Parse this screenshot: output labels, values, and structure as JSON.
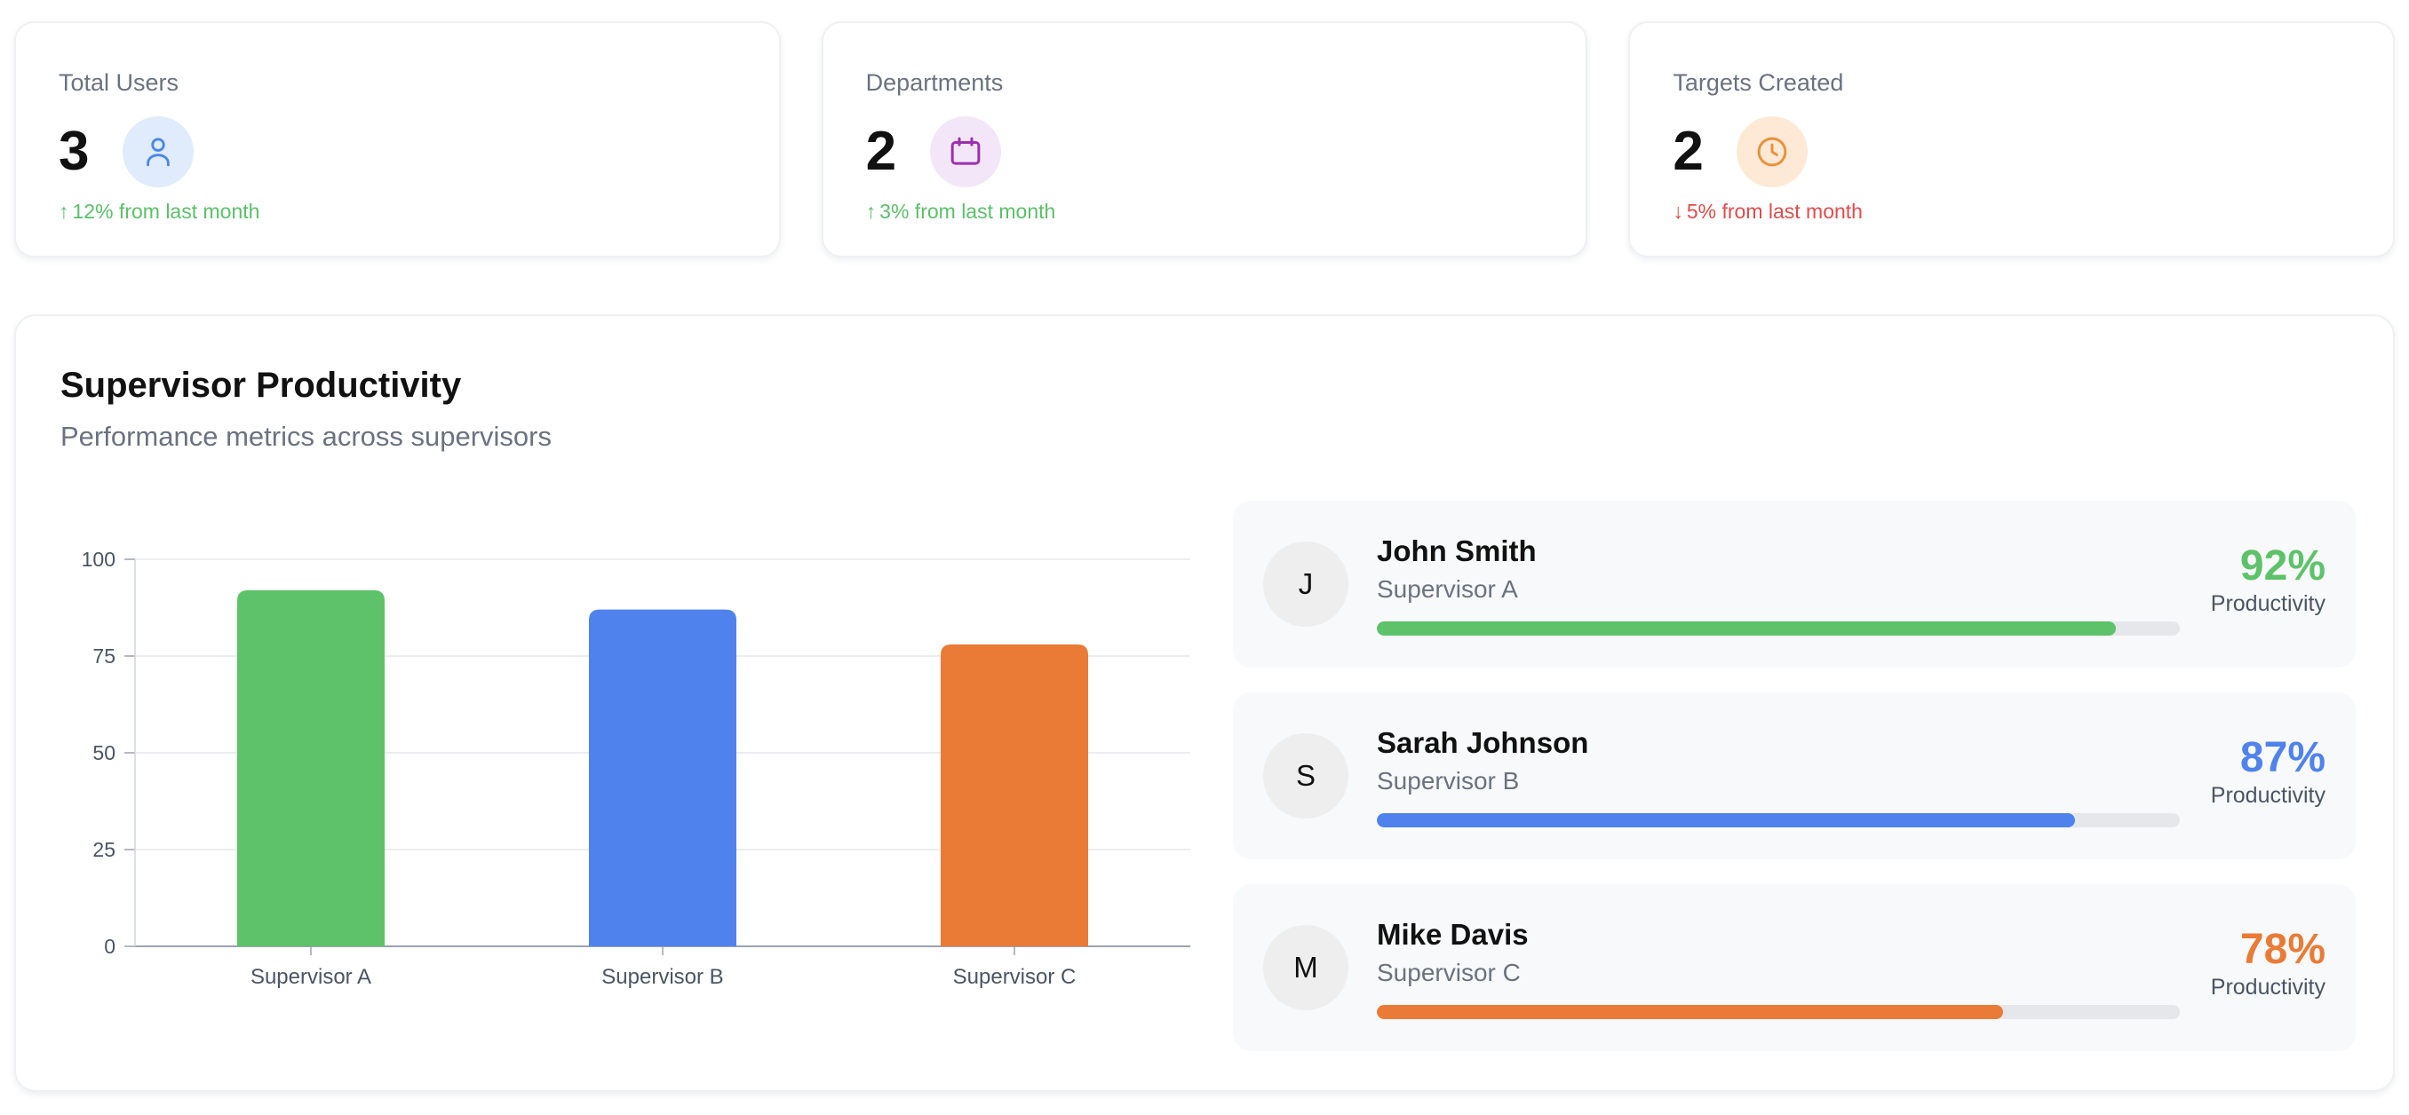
{
  "stats": [
    {
      "title": "Total Users",
      "value": "3",
      "icon": "user-icon",
      "icon_bg": "#e0ebfc",
      "icon_color": "#4a86e8",
      "trend_dir": "up",
      "trend_arrow": "↑",
      "trend_text": "12% from last month",
      "trend_color": "#5cbf6a"
    },
    {
      "title": "Departments",
      "value": "2",
      "icon": "calendar-icon",
      "icon_bg": "#f3e6f8",
      "icon_color": "#9b2fae",
      "trend_dir": "up",
      "trend_arrow": "↑",
      "trend_text": "3% from last month",
      "trend_color": "#5cbf6a"
    },
    {
      "title": "Targets Created",
      "value": "2",
      "icon": "clock-icon",
      "icon_bg": "#fde9d5",
      "icon_color": "#e8923a",
      "trend_dir": "down",
      "trend_arrow": "↓",
      "trend_text": "5% from last month",
      "trend_color": "#e14b4b"
    }
  ],
  "productivity": {
    "title": "Supervisor Productivity",
    "subtitle": "Performance metrics across supervisors",
    "metric_label": "Productivity"
  },
  "chart_data": {
    "type": "bar",
    "title": "",
    "xlabel": "",
    "ylabel": "",
    "categories": [
      "Supervisor A",
      "Supervisor B",
      "Supervisor C"
    ],
    "values": [
      92,
      87,
      78
    ],
    "colors": [
      "#5ec26a",
      "#4f82ec",
      "#e97b36"
    ],
    "ylim": [
      0,
      100
    ],
    "yticks": [
      0,
      25,
      50,
      75,
      100
    ],
    "grid": true,
    "legend": "none"
  },
  "supervisors": [
    {
      "initial": "J",
      "name": "John Smith",
      "role": "Supervisor A",
      "productivity": 92,
      "pct_text": "92%",
      "color": "#5ec26a"
    },
    {
      "initial": "S",
      "name": "Sarah Johnson",
      "role": "Supervisor B",
      "productivity": 87,
      "pct_text": "87%",
      "color": "#4f82ec"
    },
    {
      "initial": "M",
      "name": "Mike Davis",
      "role": "Supervisor C",
      "productivity": 78,
      "pct_text": "78%",
      "color": "#e97b36"
    }
  ]
}
